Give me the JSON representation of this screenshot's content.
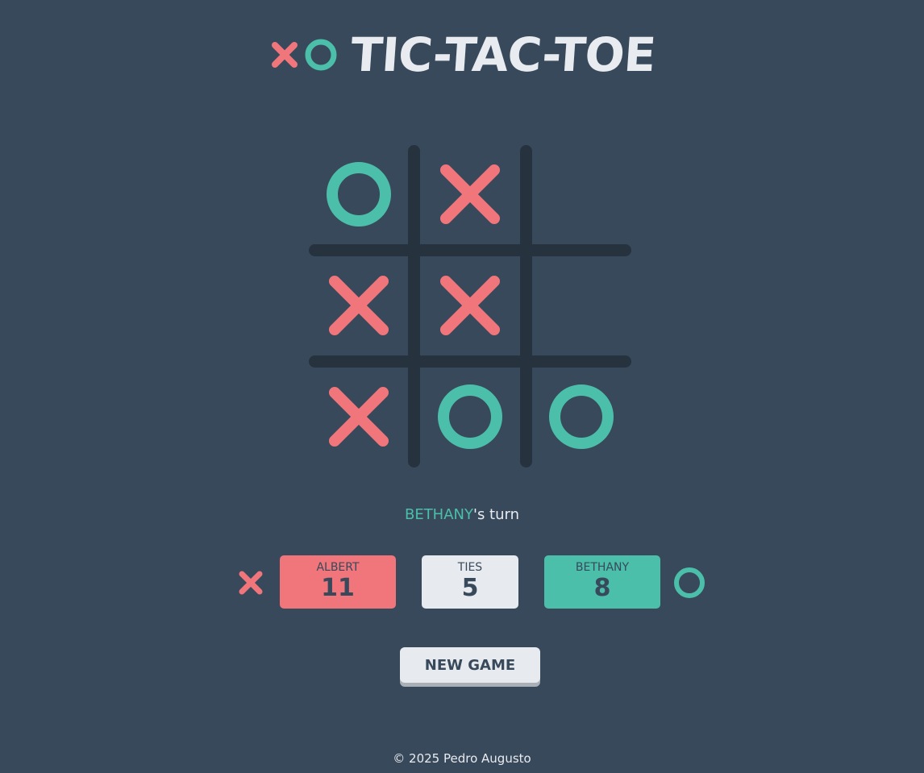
{
  "colors": {
    "background": "#38495b",
    "x_color": "#f0767b",
    "o_color": "#4bbfaa",
    "grid_color": "#26323e",
    "light": "#e7eaef"
  },
  "header": {
    "logo_icons": [
      "x-icon",
      "o-icon"
    ],
    "title": "TIC-TAC-TOE"
  },
  "board": {
    "cells": [
      "O",
      "X",
      "",
      "X",
      "X",
      "",
      "X",
      "O",
      "O"
    ]
  },
  "turn": {
    "player_name": "BETHANY",
    "suffix": "'s turn"
  },
  "scoreboard": {
    "x_player": {
      "name": "ALBERT",
      "score": "11"
    },
    "ties": {
      "label": "TIES",
      "score": "5"
    },
    "o_player": {
      "name": "BETHANY",
      "score": "8"
    }
  },
  "new_game_label": "NEW GAME",
  "footer": "© 2025 Pedro Augusto"
}
